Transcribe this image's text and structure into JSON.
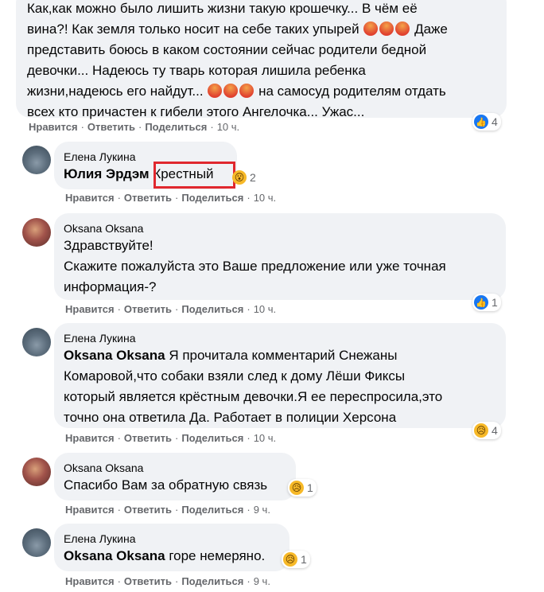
{
  "actions": {
    "like": "Нравится",
    "reply": "Ответить",
    "share": "Поделиться",
    "sep": "·"
  },
  "comments": [
    {
      "text_lines": [
        "Как,как можно было лишить жизни такую крошечку... В чём её",
        "вина?! Как земля только носит на себе таких упырей",
        "представить боюсь в каком состоянии сейчас родители бедной",
        "девочки... Надеюсь ту тварь которая лишила ребенка",
        "жизни,надеюсь его найдут...",
        "всех кто причастен к гибели этого Ангелочка... Ужас..."
      ],
      "text_tail_line2": "Даже",
      "text_tail_line5": "на самосуд родителям отдать",
      "time": "10 ч.",
      "reaction_icon": "like-icon",
      "reaction_count": "4"
    },
    {
      "author": "Елена Лукина",
      "mention": "Юлия Эрдэм",
      "text": "Крестный",
      "time": "10 ч.",
      "reaction_icon": "wow-icon",
      "reaction_count": "2"
    },
    {
      "author": "Oksana Oksana",
      "text": "Здравствуйте!\nСкажите пожалуйста это Ваше предложение или уже точная\nинформация-?",
      "time": "10 ч.",
      "reaction_icon": "like-icon",
      "reaction_count": "1"
    },
    {
      "author": "Елена Лукина",
      "mention": "Oksana Oksana",
      "text_lines": [
        "Я прочитала комментарий Снежаны",
        "Комаровой,что собаки взяли след к дому Лёши Фиксы",
        "который является крёстным девочки.Я ее переспросила,это",
        "точно она ответила Да. Работает в полиции Херсона"
      ],
      "time": "10 ч.",
      "reaction_icon": "sad-icon",
      "reaction_count": "4"
    },
    {
      "author": "Oksana Oksana",
      "text": "Спасибо Вам за обратную связь",
      "time": "9 ч.",
      "reaction_icon": "sad-icon",
      "reaction_count": "1"
    },
    {
      "author": "Елена Лукина",
      "mention": "Oksana Oksana",
      "text": "горе немеряно.",
      "time": "9 ч.",
      "reaction_icon": "sad-icon",
      "reaction_count": "1"
    }
  ],
  "colors": {
    "bubble": "#f0f2f5",
    "muted": "#65676b",
    "highlight": "#e0282e",
    "like": "#1877f2"
  }
}
